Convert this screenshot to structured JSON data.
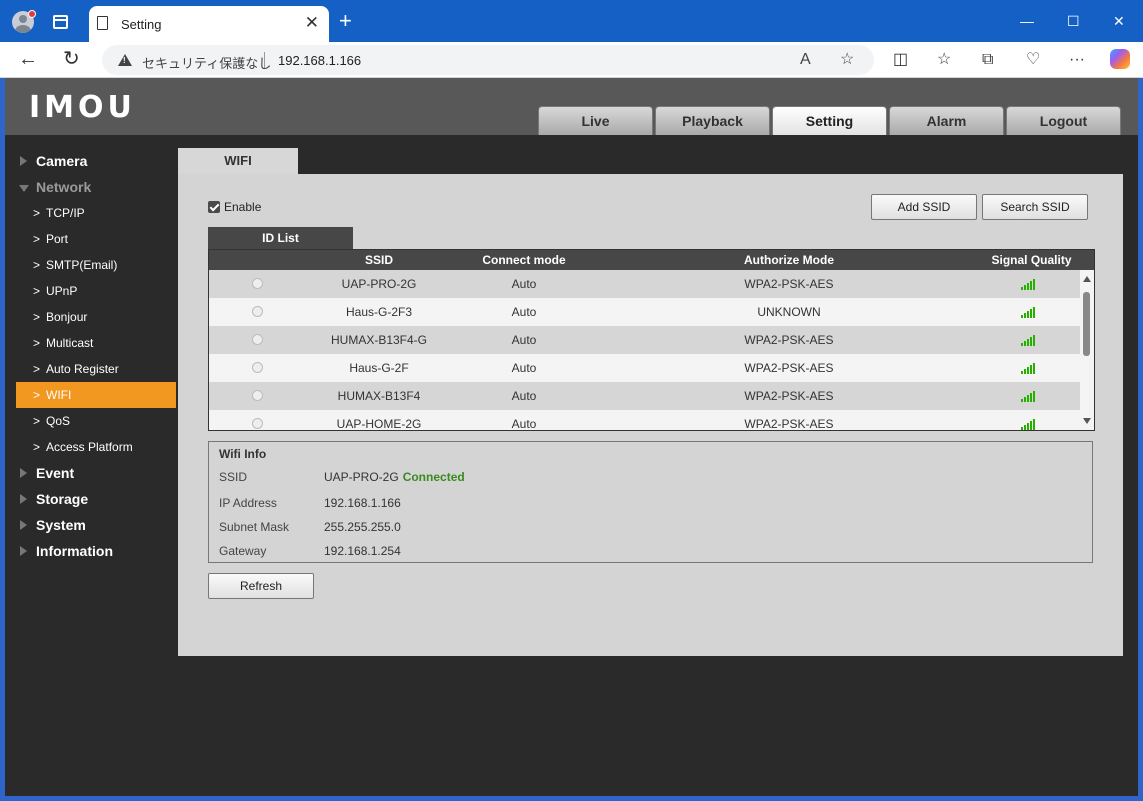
{
  "browser": {
    "tab_title": "Setting",
    "security_text": "セキュリティ保護なし",
    "url": "192.168.1.166"
  },
  "app": {
    "logo": "IMOU",
    "topnav": [
      "Live",
      "Playback",
      "Setting",
      "Alarm",
      "Logout"
    ],
    "active_topnav": "Setting",
    "sidebar": {
      "camera": "Camera",
      "network": "Network",
      "network_items": [
        "TCP/IP",
        "Port",
        "SMTP(Email)",
        "UPnP",
        "Bonjour",
        "Multicast",
        "Auto Register",
        "WIFI",
        "QoS",
        "Access Platform"
      ],
      "active_item": "WIFI",
      "event": "Event",
      "storage": "Storage",
      "system": "System",
      "information": "Information"
    },
    "content_tab": "WIFI",
    "enable_label": "Enable",
    "enable_checked": true,
    "add_ssid_label": "Add SSID",
    "search_ssid_label": "Search SSID",
    "id_list_tab": "ID List",
    "table": {
      "headers": [
        "SSID",
        "Connect mode",
        "Authorize Mode",
        "Signal Quality"
      ],
      "rows": [
        {
          "ssid": "UAP-PRO-2G",
          "mode": "Auto",
          "auth": "WPA2-PSK-AES",
          "signal": 5
        },
        {
          "ssid": "Haus-G-2F3",
          "mode": "Auto",
          "auth": "UNKNOWN",
          "signal": 5
        },
        {
          "ssid": "HUMAX-B13F4-G",
          "mode": "Auto",
          "auth": "WPA2-PSK-AES",
          "signal": 5
        },
        {
          "ssid": "Haus-G-2F",
          "mode": "Auto",
          "auth": "WPA2-PSK-AES",
          "signal": 5
        },
        {
          "ssid": "HUMAX-B13F4",
          "mode": "Auto",
          "auth": "WPA2-PSK-AES",
          "signal": 5
        },
        {
          "ssid": "UAP-HOME-2G",
          "mode": "Auto",
          "auth": "WPA2-PSK-AES",
          "signal": 5
        }
      ]
    },
    "wifi_info": {
      "title": "Wifi Info",
      "ssid_label": "SSID",
      "ssid_value": "UAP-PRO-2G",
      "status": "Connected",
      "ip_label": "IP Address",
      "ip_value": "192.168.1.166",
      "mask_label": "Subnet Mask",
      "mask_value": "255.255.255.0",
      "gateway_label": "Gateway",
      "gateway_value": "192.168.1.254"
    },
    "refresh_label": "Refresh"
  },
  "colors": {
    "accent": "#f29720",
    "signal": "#27b000",
    "connected": "#3a8a1e",
    "titlebar": "#1560c4"
  }
}
